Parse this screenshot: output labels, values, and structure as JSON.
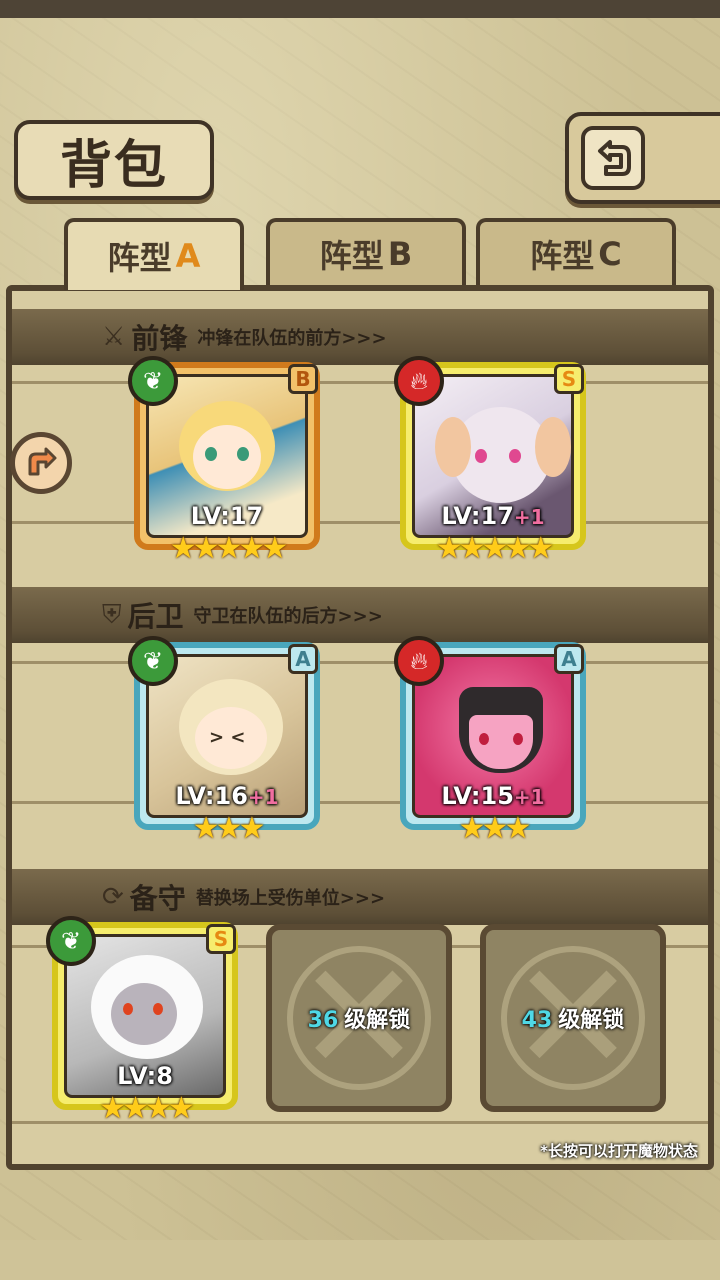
{
  "header": {
    "title": "背包"
  },
  "tabs": [
    {
      "label": "阵型",
      "letter": "A",
      "active": true
    },
    {
      "label": "阵型",
      "letter": "B",
      "active": false
    },
    {
      "label": "阵型",
      "letter": "C",
      "active": false
    }
  ],
  "sections": {
    "front": {
      "title": "前锋",
      "subtitle": "冲锋在队伍的前方>>>"
    },
    "back": {
      "title": "后卫",
      "subtitle": "守卫在队伍的后方>>>"
    },
    "reserve": {
      "title": "备守",
      "subtitle": "替换场上受伤单位>>>"
    }
  },
  "monsters": {
    "front1": {
      "rank": "B",
      "element": "leaf",
      "level": "LV:17",
      "plus": "",
      "stars": "★★★★★"
    },
    "front2": {
      "rank": "S",
      "element": "fire",
      "level": "LV:17",
      "plus": "+1",
      "stars": "★★★★★"
    },
    "back1": {
      "rank": "A",
      "element": "leaf",
      "level": "LV:16",
      "plus": "+1",
      "stars": "★★★"
    },
    "back2": {
      "rank": "A",
      "element": "fire",
      "level": "LV:15",
      "plus": "+1",
      "stars": "★★★"
    },
    "reserve1": {
      "rank": "S",
      "element": "leaf",
      "level": "LV:8",
      "plus": "",
      "stars": "★★★★"
    }
  },
  "locked_slots": [
    {
      "level": "36",
      "label": "级解锁"
    },
    {
      "level": "43",
      "label": "级解锁"
    }
  ],
  "hint": "*长按可以打开魔物状态",
  "colors": {
    "accent": "#e08a1c",
    "leaf": "#3c9a3a",
    "fire": "#d52828"
  }
}
